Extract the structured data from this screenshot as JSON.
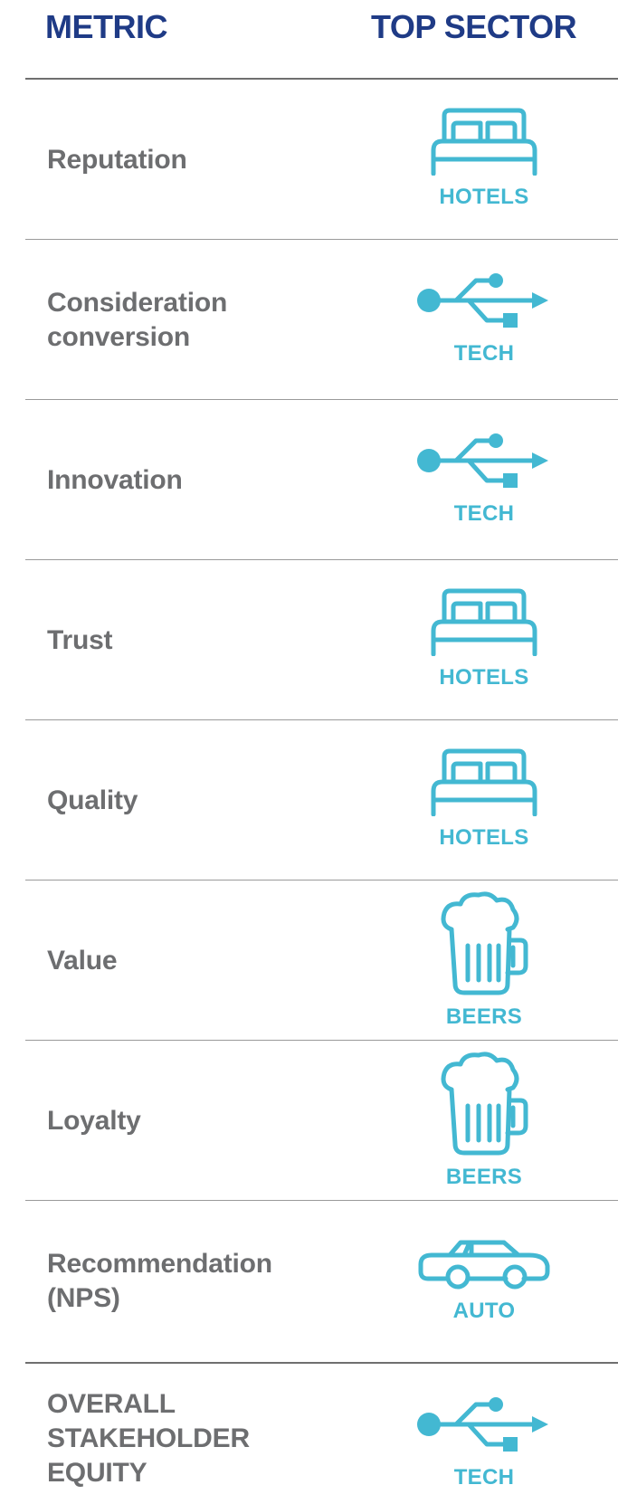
{
  "header": {
    "metric_label": "METRIC",
    "sector_label": "TOP SECTOR"
  },
  "colors": {
    "header": "#1f3b86",
    "metric_text": "#6d6e70",
    "accent": "#43b8d2",
    "rule": "#6f6f6f"
  },
  "rows": [
    {
      "metric_lines": [
        "Reputation"
      ],
      "sector": "HOTELS",
      "icon": "bed-icon"
    },
    {
      "metric_lines": [
        "Consideration",
        "conversion"
      ],
      "sector": "TECH",
      "icon": "usb-icon"
    },
    {
      "metric_lines": [
        "Innovation"
      ],
      "sector": "TECH",
      "icon": "usb-icon"
    },
    {
      "metric_lines": [
        "Trust"
      ],
      "sector": "HOTELS",
      "icon": "bed-icon"
    },
    {
      "metric_lines": [
        "Quality"
      ],
      "sector": "HOTELS",
      "icon": "bed-icon"
    },
    {
      "metric_lines": [
        "Value"
      ],
      "sector": "BEERS",
      "icon": "beer-mug-icon"
    },
    {
      "metric_lines": [
        "Loyalty"
      ],
      "sector": "BEERS",
      "icon": "beer-mug-icon"
    },
    {
      "metric_lines": [
        "Recommendation",
        "(NPS)"
      ],
      "sector": "AUTO",
      "icon": "car-icon"
    },
    {
      "metric_lines": [
        "OVERALL",
        "STAKEHOLDER",
        "EQUITY"
      ],
      "sector": "TECH",
      "icon": "usb-icon"
    }
  ]
}
